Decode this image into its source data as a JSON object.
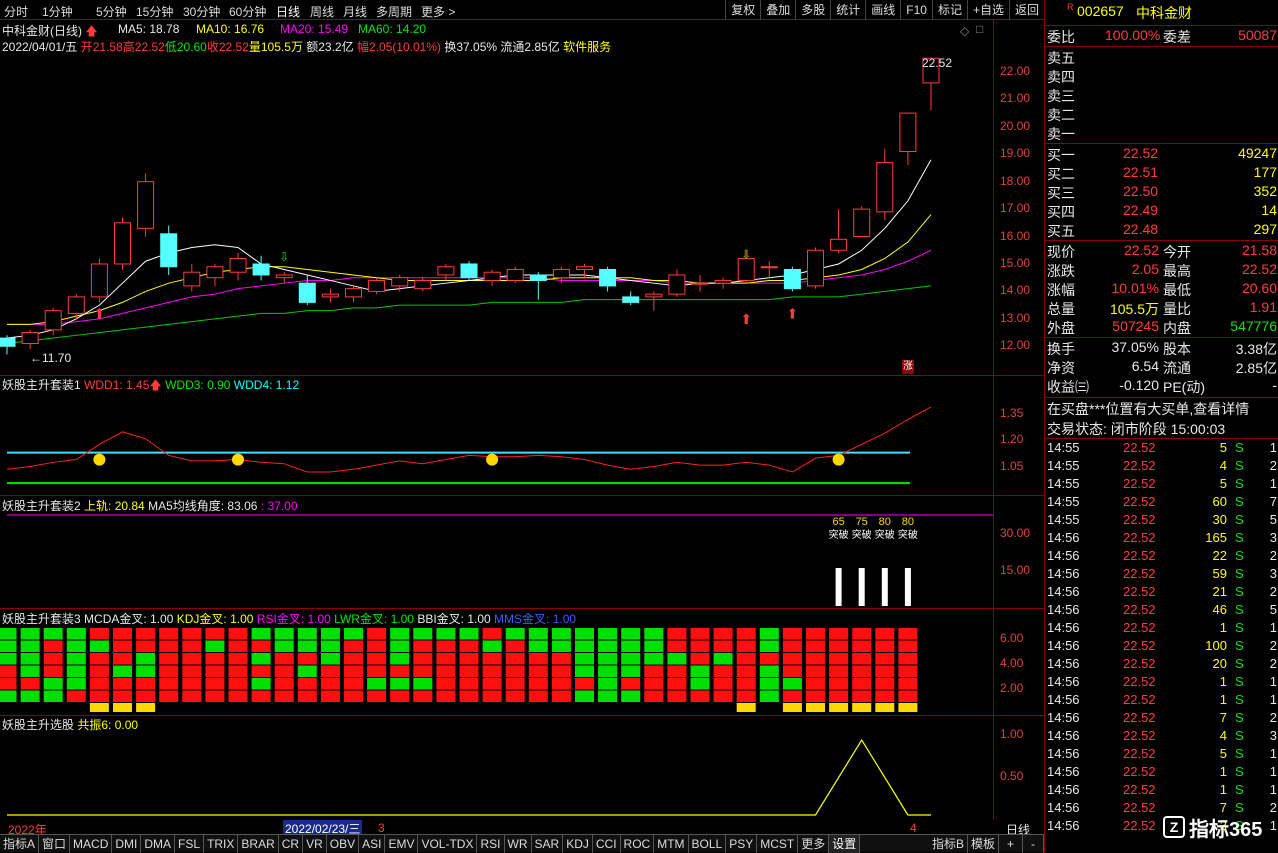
{
  "periods": [
    "分时",
    "1分钟",
    "5分钟",
    "15分钟",
    "30分钟",
    "60分钟",
    "日线",
    "周线",
    "月线",
    "多周期",
    "更多"
  ],
  "more_arrow": ">",
  "tools": [
    "复权",
    "叠加",
    "多股",
    "统计",
    "画线",
    "F10",
    "标记",
    "+自选",
    "返回"
  ],
  "main": {
    "name": "中科金财(日线)",
    "ma5": "MA5: 18.78",
    "ma10": "MA10: 16.76",
    "ma20": "MA20: 15.49",
    "ma60": "MA60: 14.20",
    "info_date": "2022/04/01/五",
    "info_open": "开21.58",
    "info_high": "高22.52",
    "info_low": "低20.60",
    "info_close": "收22.52",
    "info_vol": "量105.5万",
    "info_amt": "额23.2亿",
    "info_chg": "幅2.05(10.01%)",
    "info_turn": "换37.05%",
    "info_float": "流通2.85亿",
    "info_sector": "软件服务",
    "high_mark": "22.52",
    "low_mark": "←11.70",
    "zhang": "涨",
    "yaxis": [
      "22.00",
      "21.00",
      "20.00",
      "19.00",
      "18.00",
      "17.00",
      "16.00",
      "15.00",
      "14.00",
      "13.00",
      "12.00"
    ]
  },
  "ind1": {
    "title": "妖股主升套装1",
    "wdd1": "WDD1: 1.45",
    "wdd3": "WDD3: 0.90",
    "wdd4": "WDD4: 1.12",
    "yaxis": [
      "1.35",
      "1.20",
      "1.05"
    ]
  },
  "ind2": {
    "title": "妖股主升套装2",
    "upper": "上轨: 20.84",
    "angle": "MA5均线角度: 83.06",
    "val": ": 37.00",
    "yaxis": [
      "30.00",
      "15.00"
    ],
    "bar_labels": [
      "65",
      "75",
      "80",
      "80"
    ],
    "bar_text": "突破"
  },
  "ind3": {
    "title": "妖股主升套装3",
    "macd": "MCDA金叉: 1.00",
    "kdj": "KDJ金叉: 1.00",
    "rsi": "RSI金叉: 1.00",
    "lwr": "LWR金叉: 1.00",
    "bbi": "BBI金叉: 1.00",
    "mms": "MMS金叉: 1.00",
    "yaxis": [
      "6.00",
      "4.00",
      "2.00"
    ]
  },
  "ind4": {
    "title": "妖股主升选股",
    "gz": "共振6: 0.00",
    "yaxis": [
      "1.00",
      "0.50"
    ]
  },
  "timeaxis": {
    "year": "2022年",
    "cursor": "2022/02/23/三",
    "m3": "3",
    "m4": "4",
    "period": "日线"
  },
  "tabs": [
    "指标A",
    "窗口",
    "MACD",
    "DMI",
    "DMA",
    "FSL",
    "TRIX",
    "BRAR",
    "CR",
    "VR",
    "OBV",
    "ASI",
    "EMV",
    "VOL-TDX",
    "RSI",
    "WR",
    "SAR",
    "KDJ",
    "CCI",
    "ROC",
    "MTM",
    "BOLL",
    "PSY",
    "MCST",
    "更多",
    "设置"
  ],
  "tabs_right": [
    "指标B",
    "模板",
    "+",
    "-"
  ],
  "right": {
    "r_mark": "R",
    "code": "002657",
    "name": "中科金财",
    "wb_label": "委比",
    "wb": "100.00%",
    "wc_label": "委差",
    "wc": "50087",
    "sells": [
      "卖五",
      "卖四",
      "卖三",
      "卖二",
      "卖一"
    ],
    "buys": [
      {
        "l": "买一",
        "p": "22.52",
        "v": "49247"
      },
      {
        "l": "买二",
        "p": "22.51",
        "v": "177"
      },
      {
        "l": "买三",
        "p": "22.50",
        "v": "352"
      },
      {
        "l": "买四",
        "p": "22.49",
        "v": "14"
      },
      {
        "l": "买五",
        "p": "22.48",
        "v": "297"
      }
    ],
    "stats": [
      {
        "l1": "现价",
        "v1": "22.52",
        "l2": "今开",
        "v2": "21.58",
        "c1": "red",
        "c2": "red"
      },
      {
        "l1": "涨跌",
        "v1": "2.05",
        "l2": "最高",
        "v2": "22.52",
        "c1": "red",
        "c2": "red"
      },
      {
        "l1": "涨幅",
        "v1": "10.01%",
        "l2": "最低",
        "v2": "20.60",
        "c1": "red",
        "c2": "red"
      },
      {
        "l1": "总量",
        "v1": "105.5万",
        "l2": "量比",
        "v2": "1.91",
        "c1": "yellow",
        "c2": "red"
      },
      {
        "l1": "外盘",
        "v1": "507245",
        "l2": "内盘",
        "v2": "547776",
        "c1": "red",
        "c2": "green"
      }
    ],
    "stats2": [
      {
        "l1": "换手",
        "v1": "37.05%",
        "l2": "股本",
        "v2": "3.38亿"
      },
      {
        "l1": "净资",
        "v1": "6.54",
        "l2": "流通",
        "v2": "2.85亿"
      },
      {
        "l1": "收益㈢",
        "v1": "-0.120",
        "l2": "PE(动)",
        "v2": "-"
      }
    ],
    "notice": "在买盘***位置有大买单,查看详情",
    "status": "交易状态: 闭市阶段 15:00:03",
    "ticks": [
      [
        "14:55",
        "22.52",
        "5",
        "S",
        "1"
      ],
      [
        "14:55",
        "22.52",
        "4",
        "S",
        "2"
      ],
      [
        "14:55",
        "22.52",
        "5",
        "S",
        "1"
      ],
      [
        "14:55",
        "22.52",
        "60",
        "S",
        "7"
      ],
      [
        "14:55",
        "22.52",
        "30",
        "S",
        "5"
      ],
      [
        "14:56",
        "22.52",
        "165",
        "S",
        "3"
      ],
      [
        "14:56",
        "22.52",
        "22",
        "S",
        "2"
      ],
      [
        "14:56",
        "22.52",
        "59",
        "S",
        "3"
      ],
      [
        "14:56",
        "22.52",
        "21",
        "S",
        "2"
      ],
      [
        "14:56",
        "22.52",
        "46",
        "S",
        "5"
      ],
      [
        "14:56",
        "22.52",
        "1",
        "S",
        "1"
      ],
      [
        "14:56",
        "22.52",
        "100",
        "S",
        "2"
      ],
      [
        "14:56",
        "22.52",
        "20",
        "S",
        "2"
      ],
      [
        "14:56",
        "22.52",
        "1",
        "S",
        "1"
      ],
      [
        "14:56",
        "22.52",
        "1",
        "S",
        "1"
      ],
      [
        "14:56",
        "22.52",
        "7",
        "S",
        "2"
      ],
      [
        "14:56",
        "22.52",
        "4",
        "S",
        "3"
      ],
      [
        "14:56",
        "22.52",
        "5",
        "S",
        "1"
      ],
      [
        "14:56",
        "22.52",
        "1",
        "S",
        "1"
      ],
      [
        "14:56",
        "22.52",
        "1",
        "S",
        "1"
      ],
      [
        "14:56",
        "22.52",
        "7",
        "S",
        "2"
      ],
      [
        "14:56",
        "22.52",
        "3",
        "S",
        "1"
      ]
    ],
    "logo": "指标365"
  },
  "chart_data": {
    "type": "candlestick",
    "candles": [
      {
        "o": 12.3,
        "h": 12.4,
        "l": 11.7,
        "c": 12.0
      },
      {
        "o": 12.1,
        "h": 12.6,
        "l": 11.9,
        "c": 12.5
      },
      {
        "o": 12.6,
        "h": 13.4,
        "l": 12.4,
        "c": 13.3
      },
      {
        "o": 13.2,
        "h": 13.9,
        "l": 13.0,
        "c": 13.8
      },
      {
        "o": 13.8,
        "h": 15.2,
        "l": 13.6,
        "c": 15.0
      },
      {
        "o": 15.0,
        "h": 16.7,
        "l": 14.8,
        "c": 16.5
      },
      {
        "o": 16.3,
        "h": 18.3,
        "l": 16.0,
        "c": 18.0
      },
      {
        "o": 16.1,
        "h": 16.4,
        "l": 14.6,
        "c": 14.9
      },
      {
        "o": 14.2,
        "h": 15.0,
        "l": 14.0,
        "c": 14.7
      },
      {
        "o": 14.5,
        "h": 15.0,
        "l": 14.2,
        "c": 14.9
      },
      {
        "o": 14.7,
        "h": 15.4,
        "l": 14.4,
        "c": 15.2
      },
      {
        "o": 15.0,
        "h": 15.3,
        "l": 14.4,
        "c": 14.6
      },
      {
        "o": 14.5,
        "h": 14.7,
        "l": 14.3,
        "c": 14.6
      },
      {
        "o": 14.3,
        "h": 14.6,
        "l": 13.5,
        "c": 13.6
      },
      {
        "o": 13.8,
        "h": 14.1,
        "l": 13.6,
        "c": 13.9
      },
      {
        "o": 13.8,
        "h": 14.2,
        "l": 13.6,
        "c": 14.1
      },
      {
        "o": 14.0,
        "h": 14.5,
        "l": 13.9,
        "c": 14.4
      },
      {
        "o": 14.2,
        "h": 14.6,
        "l": 14.0,
        "c": 14.5
      },
      {
        "o": 14.1,
        "h": 14.5,
        "l": 14.0,
        "c": 14.4
      },
      {
        "o": 14.6,
        "h": 15.0,
        "l": 14.4,
        "c": 14.9
      },
      {
        "o": 15.0,
        "h": 15.1,
        "l": 14.4,
        "c": 14.5
      },
      {
        "o": 14.4,
        "h": 14.8,
        "l": 14.2,
        "c": 14.7
      },
      {
        "o": 14.4,
        "h": 14.9,
        "l": 14.3,
        "c": 14.8
      },
      {
        "o": 14.6,
        "h": 14.7,
        "l": 13.7,
        "c": 14.4
      },
      {
        "o": 14.5,
        "h": 14.9,
        "l": 14.3,
        "c": 14.8
      },
      {
        "o": 14.8,
        "h": 15.0,
        "l": 14.5,
        "c": 14.9
      },
      {
        "o": 14.8,
        "h": 14.9,
        "l": 14.0,
        "c": 14.2
      },
      {
        "o": 13.8,
        "h": 14.0,
        "l": 13.5,
        "c": 13.6
      },
      {
        "o": 13.8,
        "h": 14.0,
        "l": 13.3,
        "c": 13.9
      },
      {
        "o": 13.9,
        "h": 14.8,
        "l": 13.8,
        "c": 14.6
      },
      {
        "o": 14.3,
        "h": 14.6,
        "l": 14.0,
        "c": 14.3
      },
      {
        "o": 14.3,
        "h": 14.5,
        "l": 14.1,
        "c": 14.4
      },
      {
        "o": 14.4,
        "h": 15.5,
        "l": 14.3,
        "c": 15.2
      },
      {
        "o": 14.9,
        "h": 15.1,
        "l": 14.5,
        "c": 14.9
      },
      {
        "o": 14.8,
        "h": 14.9,
        "l": 14.0,
        "c": 14.1
      },
      {
        "o": 14.2,
        "h": 15.6,
        "l": 14.1,
        "c": 15.5
      },
      {
        "o": 15.5,
        "h": 17.0,
        "l": 15.4,
        "c": 15.9
      },
      {
        "o": 16.0,
        "h": 17.1,
        "l": 16.0,
        "c": 17.0
      },
      {
        "o": 16.9,
        "h": 19.2,
        "l": 16.6,
        "c": 18.7
      },
      {
        "o": 19.1,
        "h": 20.5,
        "l": 18.6,
        "c": 20.5
      },
      {
        "o": 21.6,
        "h": 22.5,
        "l": 20.6,
        "c": 22.5
      }
    ],
    "ylim": [
      11.5,
      22.8
    ],
    "ma5": [
      12.3,
      12.4,
      12.6,
      13.0,
      13.5,
      14.3,
      15.1,
      15.4,
      15.6,
      15.7,
      15.6,
      15.0,
      14.8,
      14.6,
      14.4,
      14.2,
      14.0,
      14.1,
      14.2,
      14.3,
      14.4,
      14.5,
      14.6,
      14.6,
      14.6,
      14.6,
      14.5,
      14.4,
      14.3,
      14.2,
      14.3,
      14.3,
      14.4,
      14.5,
      14.6,
      14.8,
      15.0,
      15.5,
      16.3,
      17.3,
      18.8
    ],
    "ma10": [
      12.8,
      12.8,
      12.9,
      13.1,
      13.3,
      13.6,
      14.0,
      14.3,
      14.5,
      14.7,
      14.8,
      14.9,
      14.9,
      14.8,
      14.7,
      14.6,
      14.5,
      14.4,
      14.4,
      14.4,
      14.4,
      14.4,
      14.4,
      14.4,
      14.5,
      14.5,
      14.5,
      14.5,
      14.4,
      14.4,
      14.3,
      14.3,
      14.3,
      14.4,
      14.4,
      14.5,
      14.6,
      14.8,
      15.2,
      15.8,
      16.8
    ],
    "ma20": [
      12.8,
      12.8,
      12.8,
      12.9,
      13.0,
      13.2,
      13.4,
      13.6,
      13.8,
      13.9,
      14.1,
      14.2,
      14.3,
      14.4,
      14.4,
      14.5,
      14.5,
      14.5,
      14.5,
      14.5,
      14.5,
      14.5,
      14.5,
      14.5,
      14.4,
      14.4,
      14.4,
      14.4,
      14.4,
      14.3,
      14.3,
      14.3,
      14.3,
      14.3,
      14.3,
      14.4,
      14.5,
      14.6,
      14.8,
      15.1,
      15.5
    ],
    "ma60": [
      12.1,
      12.2,
      12.3,
      12.4,
      12.5,
      12.6,
      12.7,
      12.8,
      12.9,
      13.0,
      13.1,
      13.2,
      13.2,
      13.3,
      13.3,
      13.4,
      13.4,
      13.5,
      13.5,
      13.5,
      13.5,
      13.6,
      13.6,
      13.6,
      13.6,
      13.7,
      13.7,
      13.7,
      13.7,
      13.7,
      13.7,
      13.7,
      13.7,
      13.7,
      13.8,
      13.8,
      13.8,
      13.9,
      14.0,
      14.1,
      14.2
    ],
    "wdd1": [
      1.0,
      1.02,
      1.05,
      1.07,
      1.18,
      1.27,
      1.22,
      1.1,
      1.06,
      1.06,
      1.07,
      1.05,
      1.04,
      0.98,
      0.98,
      1.0,
      1.03,
      1.06,
      1.04,
      1.07,
      1.1,
      1.09,
      1.09,
      1.1,
      1.09,
      1.07,
      1.03,
      1.0,
      1.02,
      1.05,
      1.03,
      1.03,
      1.05,
      1.03,
      0.98,
      1.08,
      1.1,
      1.18,
      1.26,
      1.36,
      1.45
    ],
    "wdd3": 0.9,
    "wdd4": 1.12,
    "ylim1": [
      0.85,
      1.5
    ],
    "faces": [
      4,
      10,
      21,
      36
    ],
    "breaks": [
      {
        "i": 36,
        "v": 65
      },
      {
        "i": 37,
        "v": 75
      },
      {
        "i": 38,
        "v": 80
      },
      {
        "i": 39,
        "v": 80
      }
    ],
    "grid": [
      "GGGGRRRRRRRGGGGGRGGGGRGGGGGGGRRRRGRRRRRR",
      "GGRGGRRRRGRRGGGRRGRRRGRGGGGGGRRRRGRRRRRR",
      "GGRGRRGRRRRGRRGRRGRRRRRRRGGGGGRGRRRRRRRR",
      "RGRGRGGRRRRRRGRRRRRRRRRRRGGGRRGRRGRRRRRR",
      "RRGGRRRRRRRGRRRRGGGRRRRRRRGRRRGRRGGRRRRR",
      "GGGRRRRRRRRRRRRRRRRRRRRRRGGGRRRRRGRRRRRR"
    ],
    "yellow": [
      4,
      5,
      6,
      32,
      34,
      35,
      36,
      37,
      38,
      39
    ],
    "gz": {
      "start": 35,
      "peak": 37,
      "end": 39,
      "ylim": [
        0,
        1.2
      ]
    }
  }
}
